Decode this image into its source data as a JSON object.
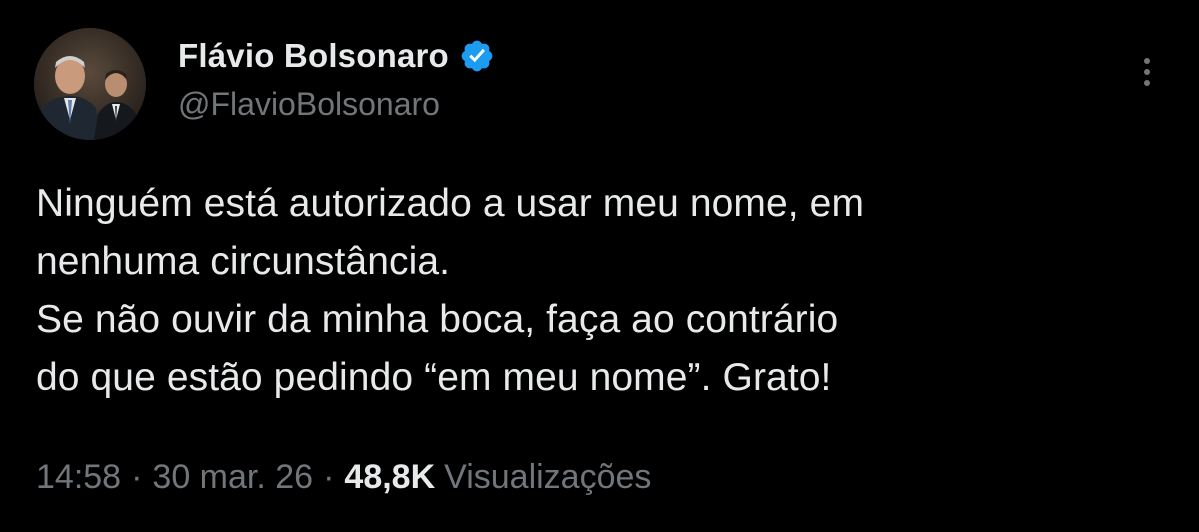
{
  "author": {
    "display_name": "Flávio Bolsonaro",
    "handle": "@FlavioBolsonaro",
    "verified": true
  },
  "tweet": {
    "lines": [
      "Ninguém está autorizado a usar meu nome, em",
      "nenhuma circunstância.",
      "Se não ouvir da minha boca, faça ao contrário",
      "do que estão pedindo “em meu nome”. Grato!"
    ]
  },
  "meta": {
    "time": "14:58",
    "date": "30 mar. 26",
    "separator": "·",
    "views_count": "48,8K",
    "views_label": "Visualizações"
  },
  "icons": {
    "verified_badge": "verified-badge-icon",
    "more": "more-options-icon"
  },
  "colors": {
    "background": "#000000",
    "primary_text": "#e7e9ea",
    "secondary_text": "#71767b",
    "verified_blue": "#1d9bf0"
  }
}
